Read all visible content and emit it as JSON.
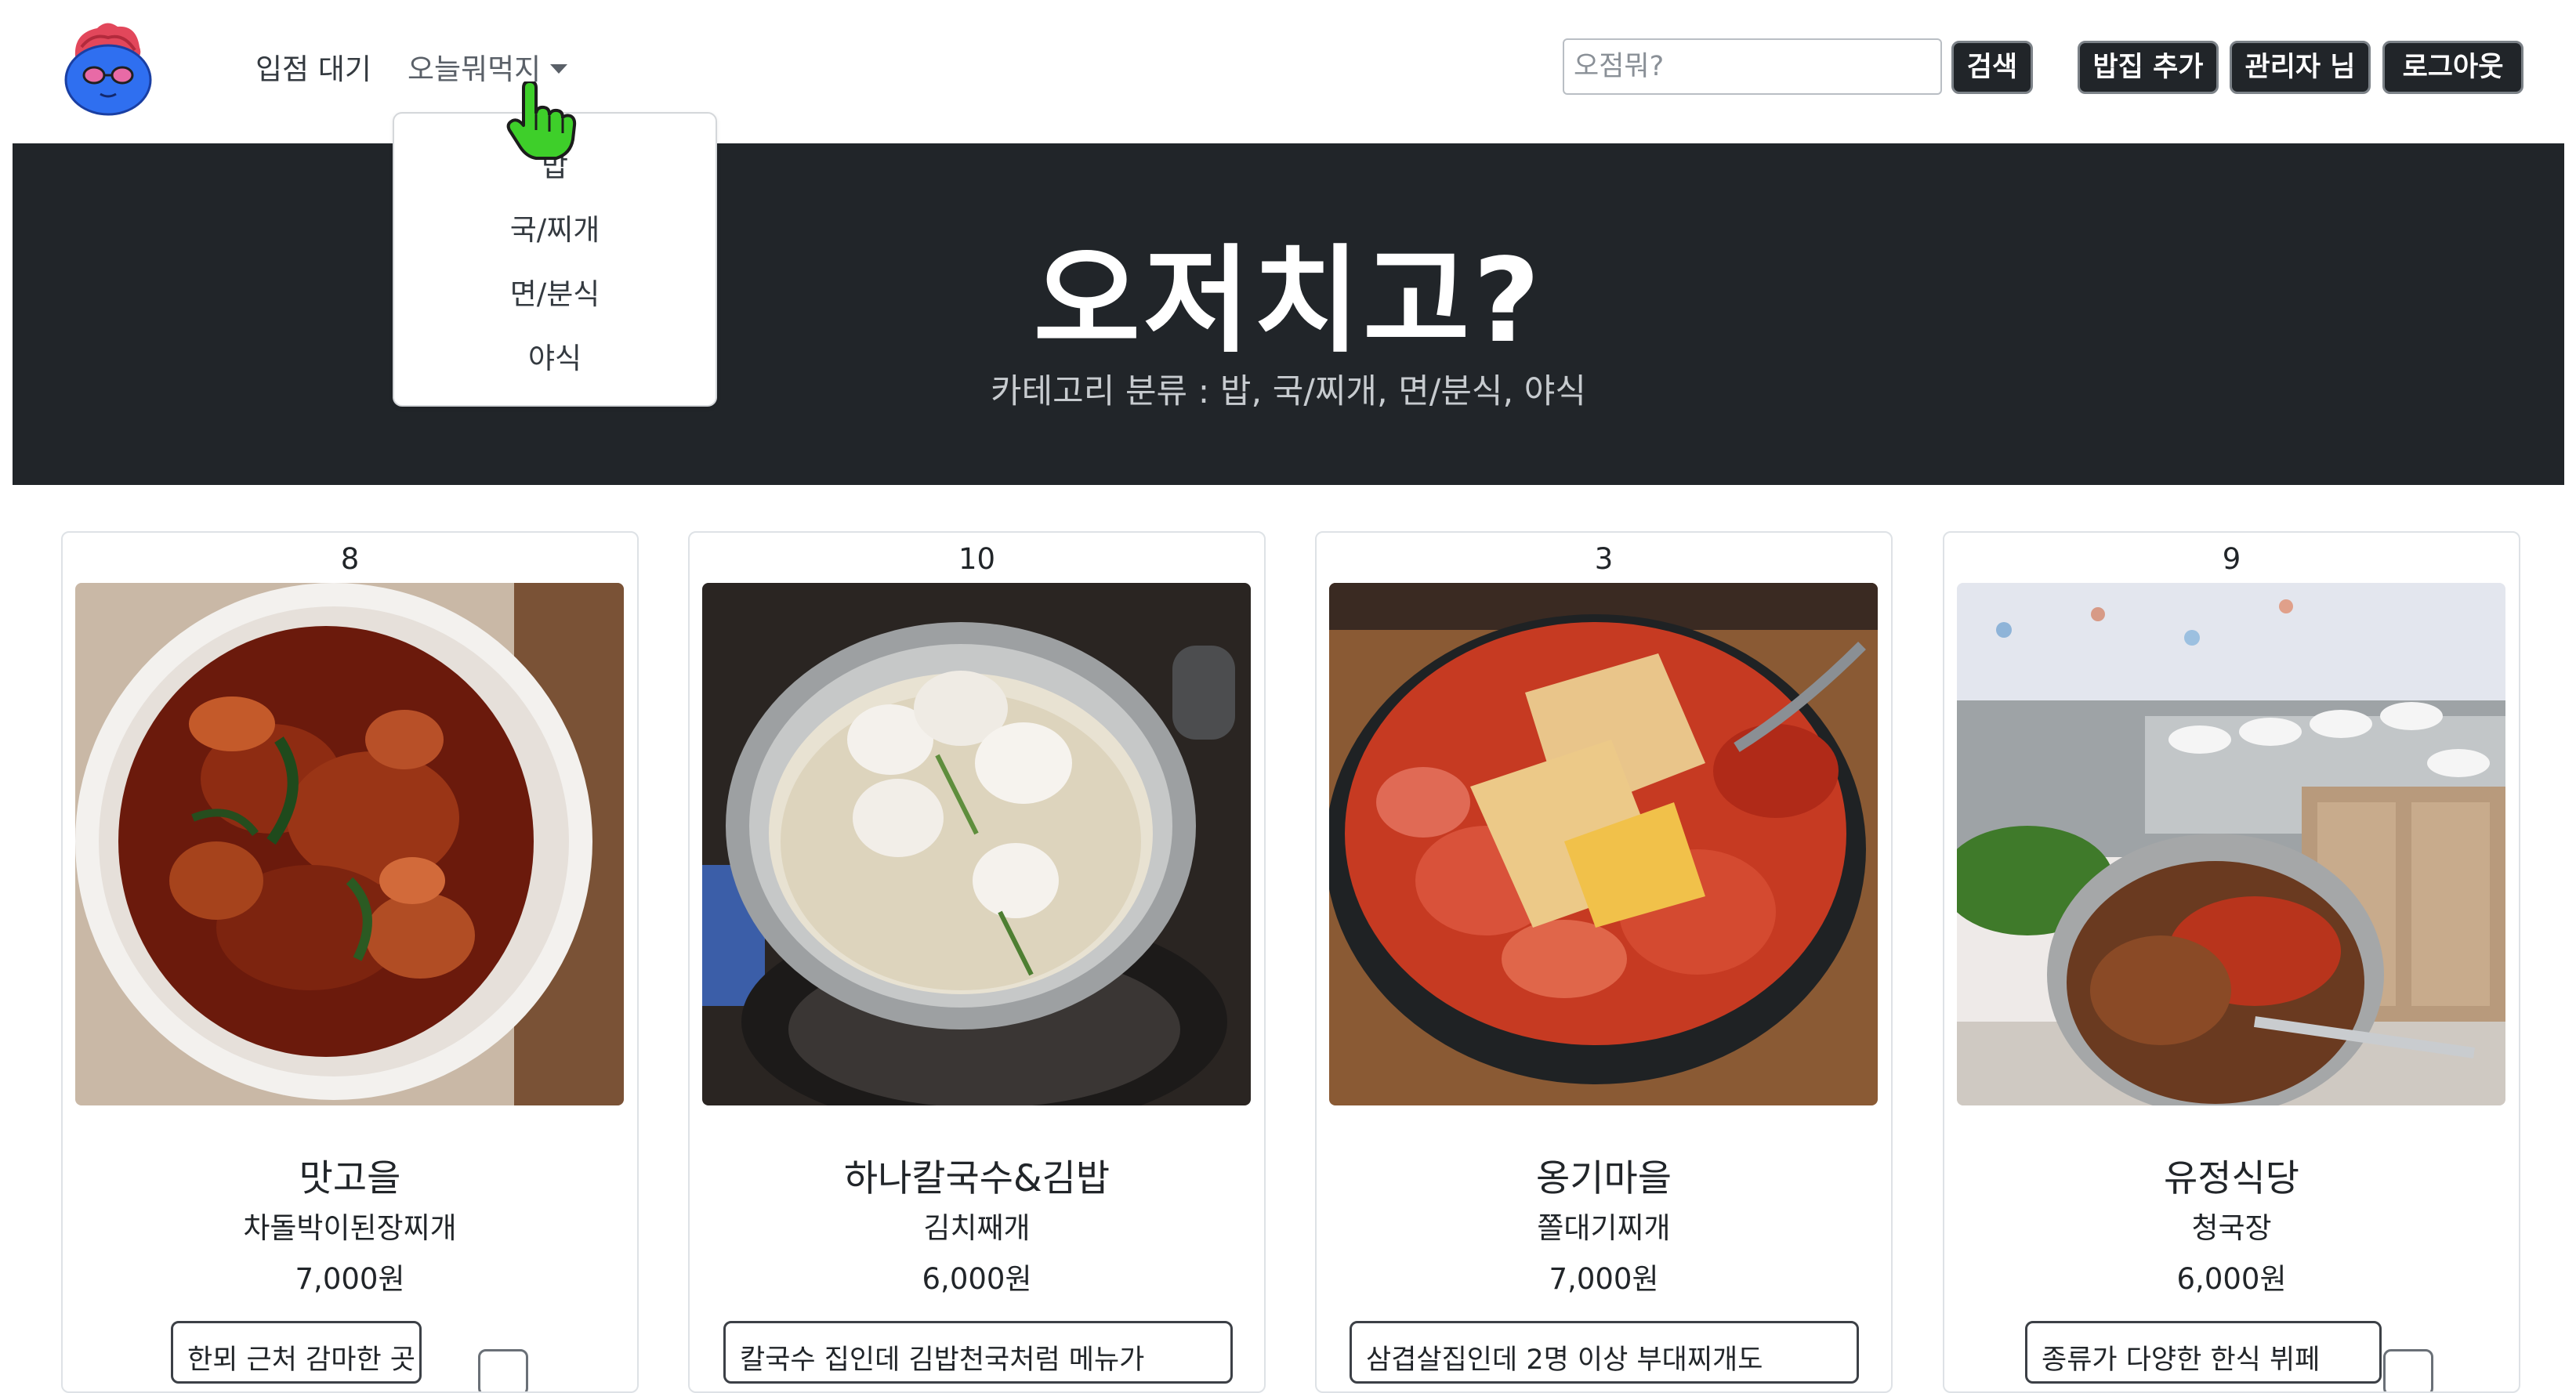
{
  "navbar": {
    "logo_icon": "mascot-logo-icon",
    "links": {
      "waiting": "입점 대기",
      "today": "오늘뭐먹지"
    },
    "search": {
      "placeholder": "오점뭐?",
      "button": "검색"
    },
    "buttons": {
      "add": "밥집 추가",
      "admin": "관리자 님",
      "logout": "로그아웃"
    }
  },
  "dropdown": {
    "items": [
      "밥",
      "국/찌개",
      "면/분식",
      "야식"
    ]
  },
  "hero": {
    "title": "오저치고?",
    "subtitle": "카테고리 분류 : 밥, 국/찌개, 면/분식, 야식"
  },
  "cards": [
    {
      "rank": "8",
      "name": "맛고을",
      "menu": "차돌박이된장찌개",
      "price": "7,000원",
      "review": "한뫼 근처 감마한 곳",
      "image": "spicy-stir-fried-squid-photo"
    },
    {
      "rank": "10",
      "name": "하나칼국수&김밥",
      "menu": "김치째개",
      "price": "6,000원",
      "review": "칼국수 집인데 김밥천국처럼 메뉴가",
      "image": "dumpling-noodle-soup-photo"
    },
    {
      "rank": "3",
      "name": "옹기마을",
      "menu": "쫄대기찌개",
      "price": "7,000원",
      "review": "삼겹살집인데 2명 이상 부대찌개도",
      "image": "army-stew-hotpot-photo"
    },
    {
      "rank": "9",
      "name": "유정식당",
      "menu": "청국장",
      "price": "6,000원",
      "review": "종류가 다양한 한식 뷔페",
      "image": "korean-buffet-photo"
    }
  ],
  "colors": {
    "hero_bg": "#212529",
    "button_bg": "#212529",
    "cursor": "#3ecf2a"
  }
}
